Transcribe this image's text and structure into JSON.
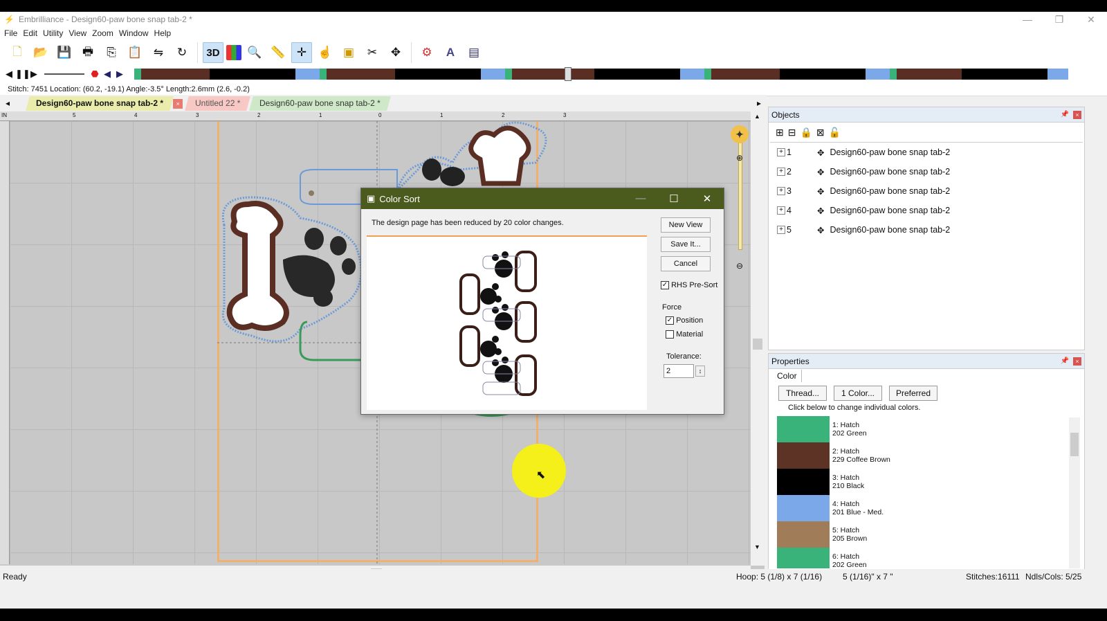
{
  "app": {
    "title": "Embrilliance - Design60-paw bone snap tab-2 *",
    "menu": [
      "File",
      "Edit",
      "Utility",
      "View",
      "Zoom",
      "Window",
      "Help"
    ]
  },
  "toolbar": {
    "icons": [
      "new-icon",
      "open-icon",
      "save-icon",
      "print-icon",
      "copy-icon",
      "paste-icon",
      "mirror-icon",
      "rotate-icon",
      "3d-view-icon",
      "color-chart-icon",
      "zoom-icon",
      "ruler-icon",
      "center-icon",
      "select-icon",
      "hoop-icon",
      "stitch-icon",
      "design-icon",
      "settings-icon",
      "text-icon",
      "export-icon"
    ],
    "three_d_label": "3D"
  },
  "color_strip": [
    {
      "color": "#3ab37a",
      "w": 10
    },
    {
      "color": "#5a2e22",
      "w": 100
    },
    {
      "color": "#000000",
      "w": 125
    },
    {
      "color": "#7aa8e8",
      "w": 35
    },
    {
      "color": "#3ab37a",
      "w": 10
    },
    {
      "color": "#5a2e22",
      "w": 100
    },
    {
      "color": "#000000",
      "w": 125
    },
    {
      "color": "#7aa8e8",
      "w": 35
    },
    {
      "color": "#3ab37a",
      "w": 10
    },
    {
      "color": "#5a2e22",
      "w": 120
    },
    {
      "color": "#000000",
      "w": 125
    },
    {
      "color": "#7aa8e8",
      "w": 35
    },
    {
      "color": "#3ab37a",
      "w": 10
    },
    {
      "color": "#5a2e22",
      "w": 100
    },
    {
      "color": "#000000",
      "w": 125
    },
    {
      "color": "#7aa8e8",
      "w": 35
    },
    {
      "color": "#3ab37a",
      "w": 10
    },
    {
      "color": "#5a2e22",
      "w": 95
    },
    {
      "color": "#000000",
      "w": 125
    },
    {
      "color": "#7aa8e8",
      "w": 30
    }
  ],
  "stitch_status": "Stitch: 7451 Location: (60.2, -19.1)  Angle:-3.5°  Length:2.6mm  (2.6, -0.2)",
  "tabs": [
    {
      "label": "Design60-paw bone snap tab-2 *",
      "active": true
    },
    {
      "label": "Untitled 22 *",
      "active": false
    },
    {
      "label": "Design60-paw bone snap tab-2 *",
      "active": false
    }
  ],
  "ruler": {
    "h_labels": [
      "5",
      "4",
      "3",
      "2",
      "1",
      "0",
      "1",
      "2",
      "3"
    ],
    "corner": "IN"
  },
  "dialog": {
    "title": "Color Sort",
    "message": "The design page has been reduced by 20 color changes.",
    "buttons": {
      "new_view": "New View",
      "save": "Save It...",
      "cancel": "Cancel"
    },
    "rhs_presort": "RHS Pre-Sort",
    "rhs_presort_checked": true,
    "force_label": "Force",
    "position_label": "Position",
    "position_checked": true,
    "material_label": "Material",
    "material_checked": false,
    "tolerance_label": "Tolerance:",
    "tolerance_value": "2"
  },
  "objects": {
    "title": "Objects",
    "items": [
      {
        "num": "1",
        "name": "Design60-paw bone snap tab-2"
      },
      {
        "num": "2",
        "name": "Design60-paw bone snap tab-2"
      },
      {
        "num": "3",
        "name": "Design60-paw bone snap tab-2"
      },
      {
        "num": "4",
        "name": "Design60-paw bone snap tab-2"
      },
      {
        "num": "5",
        "name": "Design60-paw bone snap tab-2"
      }
    ]
  },
  "properties": {
    "title": "Properties",
    "tab": "Color",
    "buttons": {
      "thread": "Thread...",
      "one_color": "1 Color...",
      "preferred": "Preferred"
    },
    "hint": "Click below to change individual colors.",
    "colors": [
      {
        "line1": "1: Hatch",
        "line2": "202 Green",
        "hex": "#3ab37a"
      },
      {
        "line1": "2: Hatch",
        "line2": "229 Coffee Brown",
        "hex": "#5c3325"
      },
      {
        "line1": "3: Hatch",
        "line2": "210 Black",
        "hex": "#000000"
      },
      {
        "line1": "4: Hatch",
        "line2": "201 Blue - Med.",
        "hex": "#7aa8e8"
      },
      {
        "line1": "5: Hatch",
        "line2": "205 Brown",
        "hex": "#a07c58"
      },
      {
        "line1": "6: Hatch",
        "line2": "202 Green",
        "hex": "#3ab37a"
      }
    ]
  },
  "statusbar": {
    "left": "Ready",
    "hoop": "Hoop: 5 (1/8) x 7 (1/16)",
    "size": "5 (1/16)\" x 7 \"",
    "stitches": "Stitches:16111",
    "ndls": "Ndls/Cols: 5/25"
  }
}
